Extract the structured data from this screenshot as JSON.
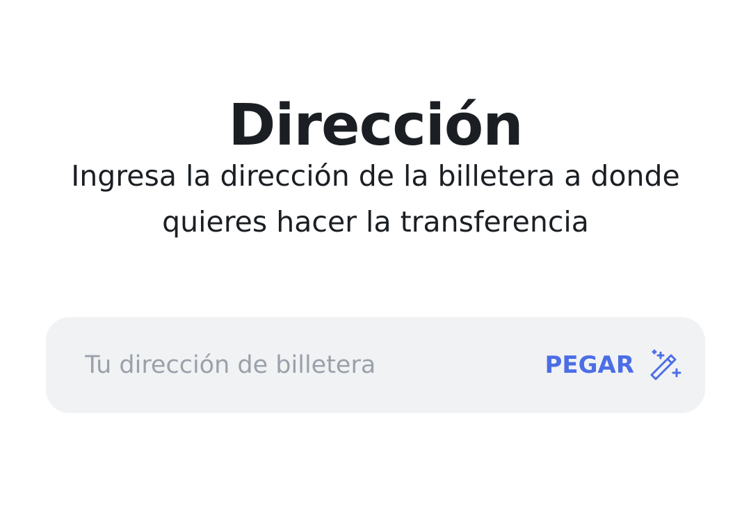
{
  "page": {
    "title": "Dirección",
    "subtitle": "Ingresa la dirección de la billetera a donde quieres hacer la transferencia"
  },
  "address_field": {
    "value": "",
    "placeholder": "Tu dirección de billetera",
    "paste_label": "PEGAR",
    "paste_icon": "magic-wand-icon"
  },
  "colors": {
    "accent": "#4c6ee5",
    "text": "#1b1f24",
    "placeholder": "#9aa1aa",
    "field_background": "#f1f2f4"
  }
}
